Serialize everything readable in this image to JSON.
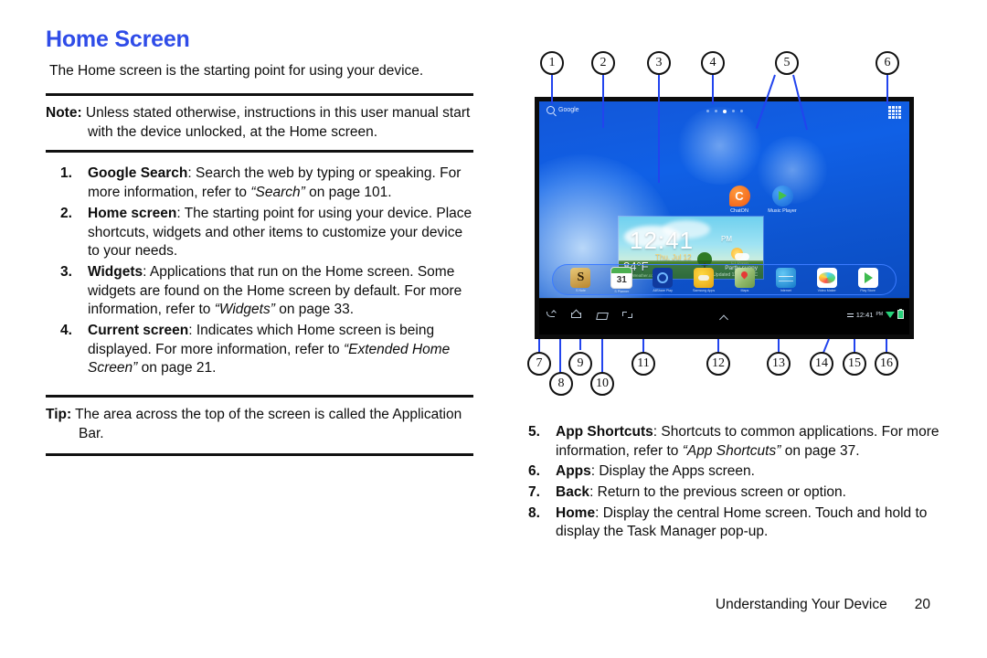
{
  "heading": "Home Screen",
  "intro": "The Home screen is the starting point for using your device.",
  "note": {
    "lead": "Note:",
    "text": " Unless stated otherwise, instructions in this user manual start with the device unlocked, at the Home screen."
  },
  "tip": {
    "lead": "Tip:",
    "text": " The area across the top of the screen is called the Application Bar."
  },
  "items_left": [
    {
      "num": "1.",
      "term": "Google Search",
      "text_a": ": Search the web by typing or speaking. For more information, refer to ",
      "ital": "“Search”",
      "text_b": " on page 101."
    },
    {
      "num": "2.",
      "term": "Home screen",
      "text_a": ": The starting point for using your device. Place shortcuts, widgets and other items to customize your device to your needs.",
      "ital": "",
      "text_b": ""
    },
    {
      "num": "3.",
      "term": "Widgets",
      "text_a": ": Applications that run on the Home screen. Some widgets are found on the Home screen by default. For more information, refer to ",
      "ital": "“Widgets”",
      "text_b": " on page 33."
    },
    {
      "num": "4.",
      "term": "Current screen",
      "text_a": ": Indicates which Home screen is being displayed. For more information, refer to ",
      "ital": "“Extended Home Screen”",
      "text_b": " on page 21."
    }
  ],
  "items_right": [
    {
      "num": "5.",
      "term": "App Shortcuts",
      "text_a": ": Shortcuts to common applications. For more information, refer to ",
      "ital": "“App Shortcuts”",
      "text_b": " on page 37."
    },
    {
      "num": "6.",
      "term": "Apps",
      "text_a": ": Display the Apps screen.",
      "ital": "",
      "text_b": ""
    },
    {
      "num": "7.",
      "term": "Back",
      "text_a": ": Return to the previous screen or option.",
      "ital": "",
      "text_b": ""
    },
    {
      "num": "8.",
      "term": "Home",
      "text_a": ": Display the central Home screen. Touch and hold to display the Task Manager pop-up.",
      "ital": "",
      "text_b": ""
    }
  ],
  "footer": {
    "section": "Understanding Your Device",
    "page": "20"
  },
  "diagram": {
    "callouts_top": [
      "1",
      "2",
      "3",
      "4",
      "5",
      "6"
    ],
    "callouts_bottom": [
      "7",
      "8",
      "9",
      "10",
      "11",
      "12",
      "13",
      "14",
      "15",
      "16"
    ],
    "leader_color": "#2244ee"
  },
  "device": {
    "search_label": "Google",
    "search_icon": "magnifier-icon",
    "apps_icon": "apps-grid-icon",
    "page_dots": 5,
    "page_dot_active": 3,
    "widget": {
      "time": "12:41",
      "meridiem": "PM",
      "date": "Thu, Jul 12",
      "temp": "84°F",
      "condition": "Partly sunny",
      "city": "El Paso",
      "source": "AccuWeather.com",
      "units": "Updated 12:41 PM  °C"
    },
    "shortcuts": [
      {
        "label": "ChatON",
        "icon": "chaton-icon"
      },
      {
        "label": "Music Player",
        "icon": "music-player-icon"
      }
    ],
    "dock": [
      {
        "label": "S Note",
        "icon": "s-note-icon"
      },
      {
        "label": "S Planner",
        "icon": "calendar-icon"
      },
      {
        "label": "AllShare Play",
        "icon": "allshare-icon"
      },
      {
        "label": "Samsung Apps",
        "icon": "samsung-apps-icon"
      },
      {
        "label": "Maps",
        "icon": "maps-icon"
      },
      {
        "label": "Internet",
        "icon": "internet-icon"
      },
      {
        "label": "Video Maker",
        "icon": "gallery-icon"
      },
      {
        "label": "Play Store",
        "icon": "play-store-icon"
      }
    ],
    "nav": [
      {
        "name": "back",
        "icon": "back-icon"
      },
      {
        "name": "home",
        "icon": "home-icon"
      },
      {
        "name": "recents",
        "icon": "recent-apps-icon"
      },
      {
        "name": "screenshot",
        "icon": "screen-capture-icon"
      }
    ],
    "status": {
      "sync_icon": "sync-icon",
      "time": "12:41",
      "meridiem": "PM",
      "wifi_icon": "wifi-icon",
      "battery_icon": "battery-icon"
    }
  }
}
